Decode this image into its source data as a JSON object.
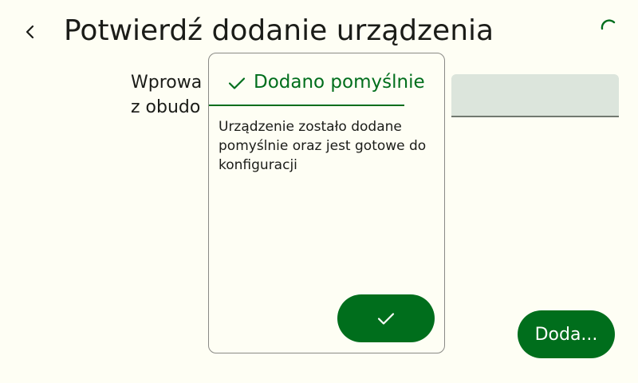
{
  "header": {
    "title": "Potwierdź dodanie urządzenia",
    "back_icon": "chevron-left-icon",
    "status_indicator": "loading-spinner-icon"
  },
  "main": {
    "instruction": "Wprowa\nz obudo",
    "code_field_value": "",
    "add_button_label": "Doda..."
  },
  "dialog": {
    "icon": "check-icon",
    "title": "Dodano pomyślnie",
    "message": "Urządzenie zostało dodane pomyślnie oraz jest gotowe do konfiguracji",
    "confirm_icon": "check-icon"
  },
  "colors": {
    "background": "#fefef4",
    "accent": "#006e1c",
    "field_background": "#dce5dc"
  }
}
